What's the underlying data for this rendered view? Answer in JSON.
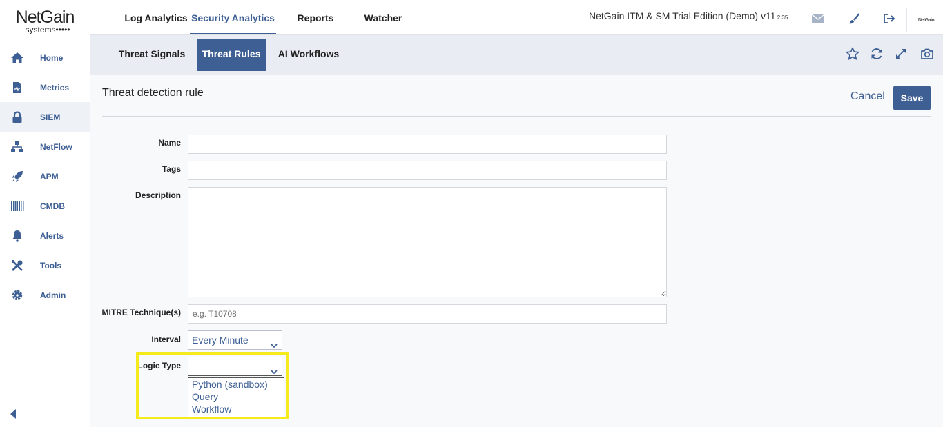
{
  "logo": {
    "main": "NetGain",
    "sub": "systems•••••"
  },
  "sidebar": {
    "items": [
      {
        "label": "Home",
        "icon": "home-icon"
      },
      {
        "label": "Metrics",
        "icon": "metrics-icon"
      },
      {
        "label": "SIEM",
        "icon": "lock-icon",
        "active": true
      },
      {
        "label": "NetFlow",
        "icon": "network-icon"
      },
      {
        "label": "APM",
        "icon": "rocket-icon"
      },
      {
        "label": "CMDB",
        "icon": "barcode-icon"
      },
      {
        "label": "Alerts",
        "icon": "bell-icon"
      },
      {
        "label": "Tools",
        "icon": "tools-icon"
      },
      {
        "label": "Admin",
        "icon": "gear-icon"
      }
    ]
  },
  "topbar": {
    "tabs": [
      "Log Analytics",
      "Security Analytics",
      "Reports",
      "Watcher"
    ],
    "active_tab": "Security Analytics",
    "edition": "NetGain ITM & SM Trial Edition (Demo) v11",
    "version_suffix": ".2.35",
    "avatar_text": "NetGain"
  },
  "subbar": {
    "tabs": [
      "Threat Signals",
      "Threat Rules",
      "AI Workflows"
    ],
    "active_tab": "Threat Rules"
  },
  "form": {
    "title": "Threat detection rule",
    "cancel_label": "Cancel",
    "save_label": "Save",
    "name_label": "Name",
    "name_value": "",
    "tags_label": "Tags",
    "tags_value": "",
    "description_label": "Description",
    "description_value": "",
    "mitre_label": "MITRE Technique(s)",
    "mitre_placeholder": "e.g. T10708",
    "interval_label": "Interval",
    "interval_value": "Every Minute",
    "logic_type_label": "Logic Type",
    "logic_type_value": "",
    "logic_type_options": [
      "Python (sandbox)",
      "Query",
      "Workflow"
    ]
  },
  "colors": {
    "accent": "#3e5f94",
    "highlight": "#f5ea1b"
  }
}
